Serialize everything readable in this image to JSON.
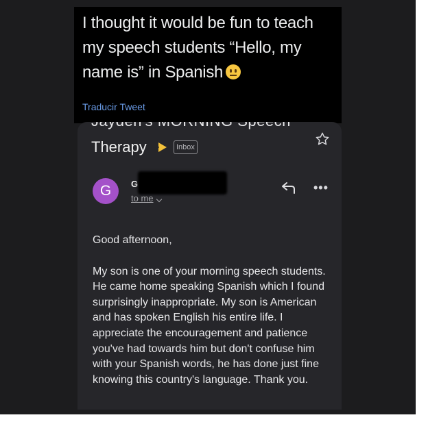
{
  "tweet": {
    "text": "I thought it would be fun to teach my speech students “Hello, my name is” in Spanish",
    "emoji_icon": "neutral-face-emoji",
    "translate_label": "Traducir Tweet"
  },
  "email": {
    "subject_partial": "Jayden's MORNING Speech",
    "subject": "Therapy",
    "label_badge": "Inbox",
    "importance_icon": "importance-marker-icon",
    "star_icon": "star-outline-icon",
    "sender_initial": "G",
    "sender_name_visible": "G",
    "recipient": "to me",
    "reply_icon": "reply-icon",
    "more_icon": "more-options-icon",
    "greeting": "Good afternoon,",
    "body": "My son is one of your morning speech students. He came home speaking Spanish which I found surprisingly inappropriate. My son is American and has spoken English his entire life. I appreciate the encouragement and patience you've had towards him but don't confuse him with your Spanish words, he has done just fine knowing this country's language. Thank you."
  },
  "colors": {
    "tweet_bg": "#000000",
    "email_bg": "#26262a",
    "avatar": "#a451c9",
    "importance": "#f3c13a",
    "link": "#6a9ce8"
  }
}
